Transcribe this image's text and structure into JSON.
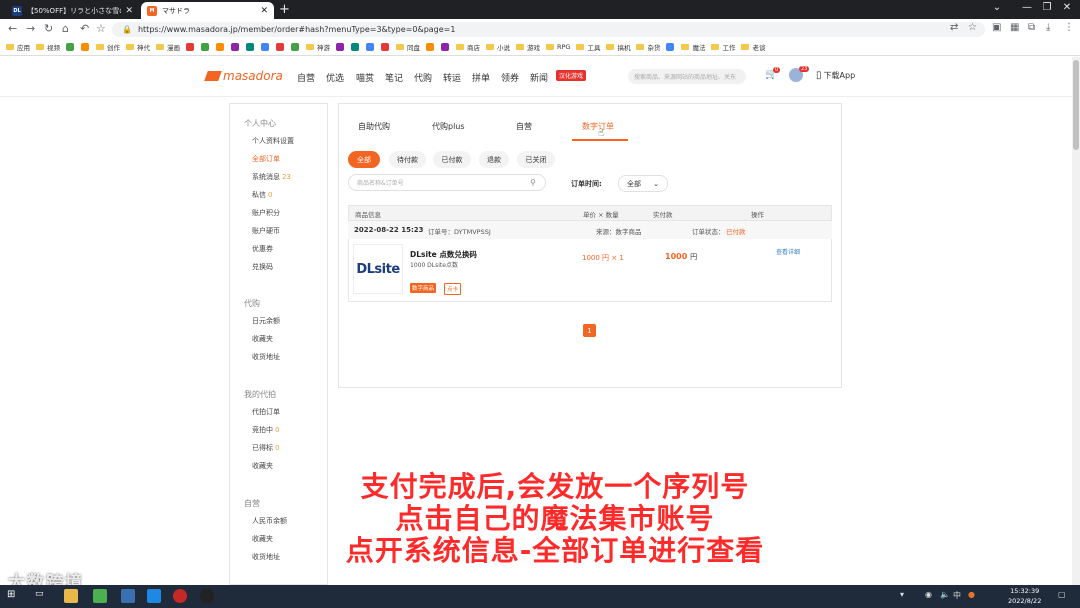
{
  "browser": {
    "tabs": [
      {
        "favicon_text": "DL",
        "favicon_color": "#1b3e7c",
        "title": "【50%OFF】リラと小さな雪の",
        "active": false
      },
      {
        "favicon_text": "M",
        "favicon_color": "#f26522",
        "title": "マサドラ",
        "active": true
      }
    ],
    "address": "https://www.masadora.jp/member/order#hash?menuType=3&type=0&page=1",
    "bookmarks": [
      {
        "label": "应用"
      },
      {
        "label": "视频"
      },
      {
        "label": ""
      },
      {
        "label": ""
      },
      {
        "label": "创作"
      },
      {
        "label": "神代"
      },
      {
        "label": "漫画"
      },
      {
        "label": ""
      },
      {
        "label": ""
      },
      {
        "label": ""
      },
      {
        "label": ""
      },
      {
        "label": ""
      },
      {
        "label": ""
      },
      {
        "label": ""
      },
      {
        "label": ""
      },
      {
        "label": "神游"
      },
      {
        "label": ""
      },
      {
        "label": ""
      },
      {
        "label": ""
      },
      {
        "label": ""
      },
      {
        "label": "同盘"
      },
      {
        "label": ""
      },
      {
        "label": ""
      },
      {
        "label": "商店"
      },
      {
        "label": "小说"
      },
      {
        "label": "游戏"
      },
      {
        "label": "RPG"
      },
      {
        "label": "工具"
      },
      {
        "label": "搞机"
      },
      {
        "label": "杂货"
      },
      {
        "label": ""
      },
      {
        "label": "魔法"
      },
      {
        "label": "工作"
      },
      {
        "label": "老谈"
      }
    ]
  },
  "site": {
    "logo_text": "masadora",
    "nav": [
      "自营",
      "优选",
      "喵赏",
      "笔记",
      "代购",
      "转运",
      "拼单",
      "领券",
      "新闻"
    ],
    "nav_badge": "汉化游戏",
    "search_placeholder": "搜索商品、来源网站的商品地址、关东",
    "cart_count": "0",
    "msg_count": "23",
    "download_label": "下载App"
  },
  "sidebar": {
    "sections": [
      {
        "title": "个人中心",
        "items": [
          {
            "label": "个人资料设置",
            "count": ""
          },
          {
            "label": "全部订单",
            "count": "",
            "active": true
          },
          {
            "label": "系统消息",
            "count": "23"
          },
          {
            "label": "私信",
            "count": "0"
          },
          {
            "label": "账户积分",
            "count": ""
          },
          {
            "label": "账户硬币",
            "count": ""
          },
          {
            "label": "优惠券",
            "count": ""
          },
          {
            "label": "兑换码",
            "count": ""
          }
        ]
      },
      {
        "title": "代购",
        "items": [
          {
            "label": "日元余额",
            "count": ""
          },
          {
            "label": "收藏夹",
            "count": ""
          },
          {
            "label": "收货地址",
            "count": ""
          }
        ]
      },
      {
        "title": "我的代拍",
        "items": [
          {
            "label": "代拍订单",
            "count": ""
          },
          {
            "label": "竞拍中",
            "count": "0"
          },
          {
            "label": "已得标",
            "count": "0"
          },
          {
            "label": "收藏夹",
            "count": ""
          }
        ]
      },
      {
        "title": "自营",
        "items": [
          {
            "label": "人民币余额",
            "count": ""
          },
          {
            "label": "收藏夹",
            "count": ""
          },
          {
            "label": "收货地址",
            "count": ""
          }
        ]
      }
    ]
  },
  "orders": {
    "tabs": [
      "自助代购",
      "代购plus",
      "自营",
      "数字订单"
    ],
    "active_tab": "数字订单",
    "filters": [
      "全部",
      "待付款",
      "已付款",
      "退款",
      "已关闭"
    ],
    "search_placeholder": "商品名称&订单号",
    "time_label": "订单时间:",
    "time_value": "全部",
    "columns": [
      "商品信息",
      "单价 × 数量",
      "实付款",
      "操作"
    ],
    "order": {
      "date": "2022-08-22 15:23",
      "order_no": "订单号：DYTMVPSSJ",
      "source": "来源：数字商品",
      "status_label": "订单状态：",
      "status": "已付款",
      "product_logo": "DLsite",
      "product_name": "DLsite 点数兑换码",
      "product_sub": "1000 DLsite点数",
      "tag1": "数字商品",
      "tag2": "点卡",
      "unit_price": "1000 円 × 1",
      "total": "1000",
      "total_unit": "円",
      "detail_link": "查看详细"
    },
    "page": "1"
  },
  "caption_lines": [
    "支付完成后,会发放一个序列号",
    "点击自己的魔法集市账号",
    "点开系统信息-全部订单进行查看"
  ],
  "watermark": "大数跨境",
  "taskbar": {
    "time": "15:32:39",
    "date": "2022/8/22",
    "ime": "中"
  }
}
